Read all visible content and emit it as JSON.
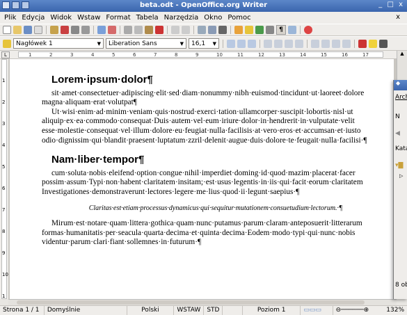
{
  "window": {
    "title": "beta.odt - OpenOffice.org Writer",
    "controls": "_ □ x"
  },
  "menu": [
    "Plik",
    "Edycja",
    "Widok",
    "Wstaw",
    "Format",
    "Tabela",
    "Narzędzia",
    "Okno",
    "Pomoc"
  ],
  "menu_close": "x",
  "format_toolbar": {
    "style": "Nagłówek 1",
    "font": "Liberation Sans",
    "size": "16,1"
  },
  "ruler_numbers": [
    "1",
    "2",
    "3",
    "4",
    "5",
    "6",
    "7",
    "8",
    "9",
    "10",
    "11",
    "12",
    "13",
    "14",
    "15",
    "16",
    "17"
  ],
  "vruler_numbers": [
    "1",
    "2",
    "3",
    "4",
    "5",
    "6",
    "7",
    "8",
    "9",
    "10",
    "1"
  ],
  "document": {
    "heading1": "Lorem·ipsum·dolor¶",
    "para1": "sit·amet·consectetuer·adipiscing·elit·sed·diam·nonummy·nibh·euismod·tincidunt·ut·laoreet·dolore magna·aliquam·erat·volutpat¶",
    "para2": "Ut·wisi·enim·ad·minim·veniam·quis·nostrud·exerci·tation·ullamcorper·suscipit·lobortis·nisl·ut aliquip·ex·ea·commodo·consequat·Duis·autem·vel·eum·iriure·dolor·in·hendrerit·in·vulputate·velit esse·molestie·consequat·vel·illum·dolore·eu·feugiat·nulla·facilisis·at·vero·eros·et·accumsan·et·iusto odio·dignissim·qui·blandit·praesent·luptatum·zzril·delenit·augue·duis·dolore·te·feugait·nulla·facilisi·¶",
    "heading2": "Nam·liber·tempor¶",
    "para3": "cum·soluta·nobis·eleifend·option·congue·nihil·imperdiet·doming·id·quod·mazim·placerat·facer possim·assum·Typi·non·habent·claritatem·insitam;·est·usus·legentis·in·iis·qui·facit·eorum·claritatem Investigationes·demonstraverunt·lectores·legere·me·lius·quod·ii·legunt·saepius·¶",
    "quote": "Claritas·est·etiam·processus·dynamicus·qui·sequitur·mutationem·consuetudium·lectorum.·¶",
    "para4": "Mirum·est·notare·quam·littera·gothica·quam·nunc·putamus·parum·claram·anteposuerit·litterarum formas·humanitatis·per·seacula·quarta·decima·et·quinta·decima·Eodem·modo·typi·qui·nunc·nobis videntur·parum·clari·fiant·sollemnes·in·futurum·¶"
  },
  "status": {
    "page": "Strona 1 / 1",
    "style": "Domyślnie",
    "lang": "Polski",
    "mode": "WSTAW",
    "sel": "STD",
    "level": "Poziom 1",
    "zoom": "132%"
  },
  "side_window": {
    "menu": "Arch",
    "item1": "N",
    "item2": "Kata",
    "count": "8 obi"
  }
}
